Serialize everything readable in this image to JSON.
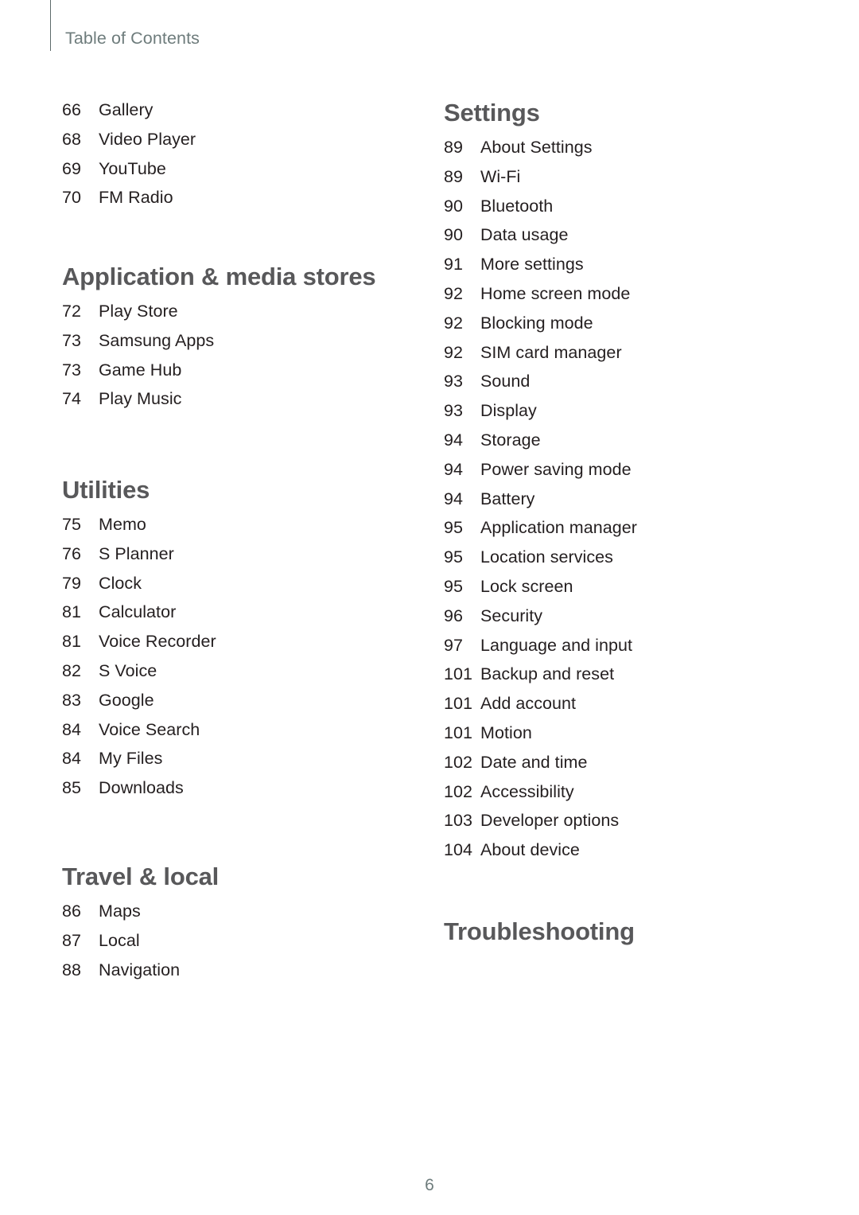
{
  "header": {
    "title": "Table of Contents"
  },
  "footer": {
    "page_number": "6"
  },
  "colors": {
    "header_text": "#6e7c7c",
    "heading_text": "#58585a",
    "body_text": "#241f20",
    "rule": "#5d6a6a",
    "background": "#ffffff"
  },
  "columns": [
    {
      "name": "left",
      "sections": [
        {
          "heading": null,
          "entries": [
            {
              "page": "66",
              "label": "Gallery"
            },
            {
              "page": "68",
              "label": "Video Player"
            },
            {
              "page": "69",
              "label": "YouTube"
            },
            {
              "page": "70",
              "label": "FM Radio"
            }
          ]
        },
        {
          "heading": "Application & media stores",
          "entries": [
            {
              "page": "72",
              "label": "Play Store"
            },
            {
              "page": "73",
              "label": "Samsung Apps"
            },
            {
              "page": "73",
              "label": "Game Hub"
            },
            {
              "page": "74",
              "label": "Play Music"
            }
          ]
        },
        {
          "heading": "Utilities",
          "entries": [
            {
              "page": "75",
              "label": "Memo"
            },
            {
              "page": "76",
              "label": "S Planner"
            },
            {
              "page": "79",
              "label": "Clock"
            },
            {
              "page": "81",
              "label": "Calculator"
            },
            {
              "page": "81",
              "label": "Voice Recorder"
            },
            {
              "page": "82",
              "label": "S Voice"
            },
            {
              "page": "83",
              "label": "Google"
            },
            {
              "page": "84",
              "label": "Voice Search"
            },
            {
              "page": "84",
              "label": "My Files"
            },
            {
              "page": "85",
              "label": "Downloads"
            }
          ]
        },
        {
          "heading": "Travel & local",
          "entries": [
            {
              "page": "86",
              "label": "Maps"
            },
            {
              "page": "87",
              "label": "Local"
            },
            {
              "page": "88",
              "label": "Navigation"
            }
          ]
        }
      ]
    },
    {
      "name": "right",
      "sections": [
        {
          "heading": "Settings",
          "entries": [
            {
              "page": "89",
              "label": "About Settings"
            },
            {
              "page": "89",
              "label": "Wi-Fi"
            },
            {
              "page": "90",
              "label": "Bluetooth"
            },
            {
              "page": "90",
              "label": "Data usage"
            },
            {
              "page": "91",
              "label": "More settings"
            },
            {
              "page": "92",
              "label": "Home screen mode"
            },
            {
              "page": "92",
              "label": "Blocking mode"
            },
            {
              "page": "92",
              "label": "SIM card manager"
            },
            {
              "page": "93",
              "label": "Sound"
            },
            {
              "page": "93",
              "label": "Display"
            },
            {
              "page": "94",
              "label": "Storage"
            },
            {
              "page": "94",
              "label": "Power saving mode"
            },
            {
              "page": "94",
              "label": "Battery"
            },
            {
              "page": "95",
              "label": "Application manager"
            },
            {
              "page": "95",
              "label": "Location services"
            },
            {
              "page": "95",
              "label": "Lock screen"
            },
            {
              "page": "96",
              "label": "Security"
            },
            {
              "page": "97",
              "label": "Language and input"
            },
            {
              "page": "101",
              "label": "Backup and reset"
            },
            {
              "page": "101",
              "label": "Add account"
            },
            {
              "page": "101",
              "label": "Motion"
            },
            {
              "page": "102",
              "label": "Date and time"
            },
            {
              "page": "102",
              "label": "Accessibility"
            },
            {
              "page": "103",
              "label": "Developer options"
            },
            {
              "page": "104",
              "label": "About device"
            }
          ]
        },
        {
          "heading": "Troubleshooting",
          "entries": []
        }
      ]
    }
  ]
}
